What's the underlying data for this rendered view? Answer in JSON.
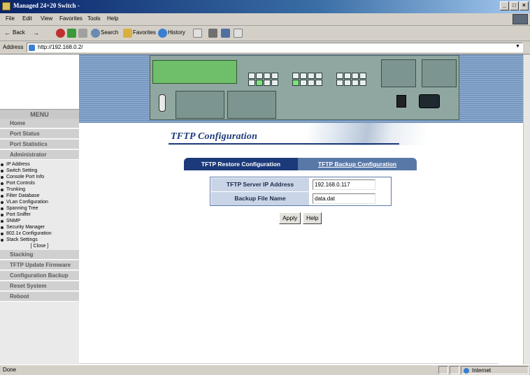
{
  "window": {
    "title": "Managed 24+20 Switch -",
    "controls": [
      "_",
      "□",
      "×"
    ]
  },
  "menubar": {
    "items": [
      "File",
      "Edit",
      "View",
      "Favorites",
      "Tools",
      "Help"
    ]
  },
  "toolbar": {
    "back": "Back",
    "search": "Search",
    "favorites": "Favorites",
    "history": "History"
  },
  "address": {
    "label": "Address",
    "url": "http://192.168.0.2/"
  },
  "sidebar": {
    "title": "MENU",
    "items": [
      "Home",
      "Port Status",
      "Port Statistics",
      "Administrator"
    ],
    "admin_subitems": [
      "IP Address",
      "Switch Setting",
      "Console Port Info",
      "Port Controls",
      "Trunking",
      "Filter Database",
      "VLan Configuration",
      "Spanning Tree",
      "Port Sniffer",
      "SNMP",
      "Security Manager",
      "802.1x Configuration",
      "Stack Settings"
    ],
    "close_label": "[ Close ]",
    "bottom_items": [
      "Stacking",
      "TFTP Update Firmware",
      "Configuration Backup",
      "Reset System",
      "Reboot"
    ]
  },
  "main": {
    "title": "TFTP Configuration",
    "tabs": [
      "TFTP Restore Configuration",
      "TFTP Backup Configuration"
    ],
    "fields": [
      {
        "label": "TFTP Server IP Address",
        "value": "192.168.0.117"
      },
      {
        "label": "Backup File Name",
        "value": "data.dat"
      }
    ],
    "buttons": {
      "apply": "Apply",
      "help": "Help"
    }
  },
  "status": {
    "text": "Done",
    "zone": "Internet"
  },
  "colors": {
    "title_blue": "#1c3a7a",
    "tab_active": "#1c3a7a",
    "tab_inactive": "#5878a8",
    "field_label_bg": "#c9d5e6"
  }
}
